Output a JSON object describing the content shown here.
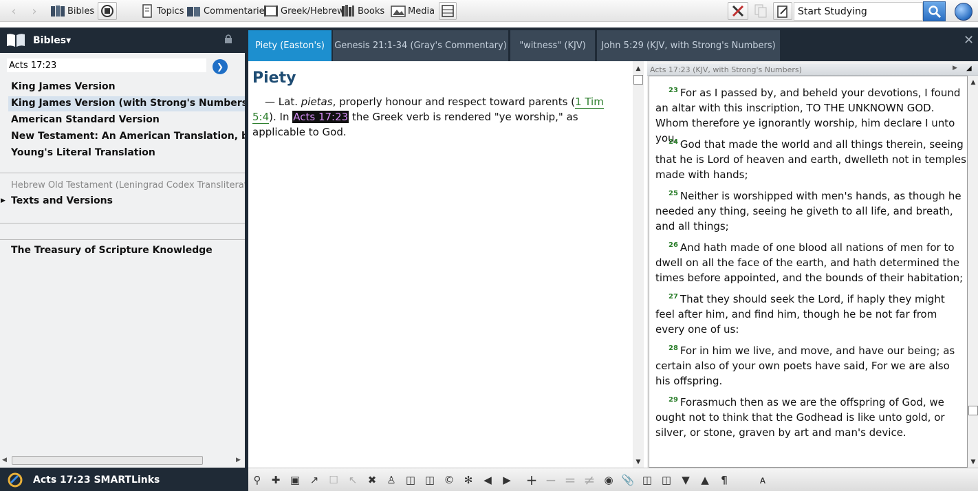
{
  "toolbar": {
    "bibles": "Bibles",
    "topics": "Topics",
    "commentaries": "Commentaries",
    "greek_hebrew": "Greek/Hebrew",
    "books": "Books",
    "media": "Media",
    "search_value": "Start Studying"
  },
  "left_panel": {
    "title": "Bibles▾",
    "reference": "Acts 17:23",
    "versions": [
      "King James Version",
      "King James Version (with Strong's Numbers)",
      "American Standard Version",
      "New Testament: An American Translation, by E. J.",
      "Young's Literal Translation"
    ],
    "selected_index": 1,
    "grey_item": "Hebrew Old Testament (Leningrad Codex Transliterate",
    "group_item": "Texts and Versions",
    "treasury": "The Treasury of Scripture Knowledge",
    "footer": "Acts 17:23 SMARTLinks"
  },
  "tabs": [
    {
      "label": "Piety (Easton's)",
      "active": true
    },
    {
      "label": "Genesis 21:1-34 (Gray's Commentary)",
      "active": false
    },
    {
      "label": "\"witness\" (KJV)",
      "active": false
    },
    {
      "label": "John 5:29 (KJV, with Strong's Numbers)",
      "active": false
    }
  ],
  "article": {
    "title": "Piety",
    "p1_a": "— Lat.",
    "p1_italic": "pietas",
    "p1_b": ", properly honour and respect toward parents (",
    "xref": "1 Tim 5:4",
    "p1_c": ").",
    "p2_a": "In",
    "hl_ref": "Acts 17:23",
    "p2_b": "the Greek verb is rendered \"ye worship,\" as applicable to",
    "p2_c": "God."
  },
  "right_pane": {
    "header": "Acts 17:23 (KJV, with Strong's Numbers)",
    "verses": [
      {
        "num": "23",
        "text": "For as I passed by, and beheld your devotions, I found an altar with this inscription, TO THE UNKNOWN GOD. Whom therefore ye ignorantly worship, him declare I unto you."
      },
      {
        "num": "24",
        "text": "God that made the world and all things therein, seeing that he is Lord of heaven and earth, dwelleth not in temples made with hands;"
      },
      {
        "num": "25",
        "text": "Neither is worshipped with men's hands, as though he needed any thing, seeing he giveth to all life, and breath, and all things;"
      },
      {
        "num": "26",
        "text": "And hath made of one blood all nations of men for to dwell on all the face of the earth, and hath determined the times before appointed, and the bounds of their habitation;"
      },
      {
        "num": "27",
        "text": "That they should seek the Lord, if haply they might feel after him, and find him, though he be not far from every one of us:"
      },
      {
        "num": "28",
        "text": "For in him we live, and move, and have our being; as certain also of your own poets have said, For we are also his offspring."
      },
      {
        "num": "29",
        "text": "Forasmuch then as we are the offspring of God, we ought not to think that the Godhead is like unto gold, or silver, or stone, graven by art and man's device."
      }
    ]
  }
}
